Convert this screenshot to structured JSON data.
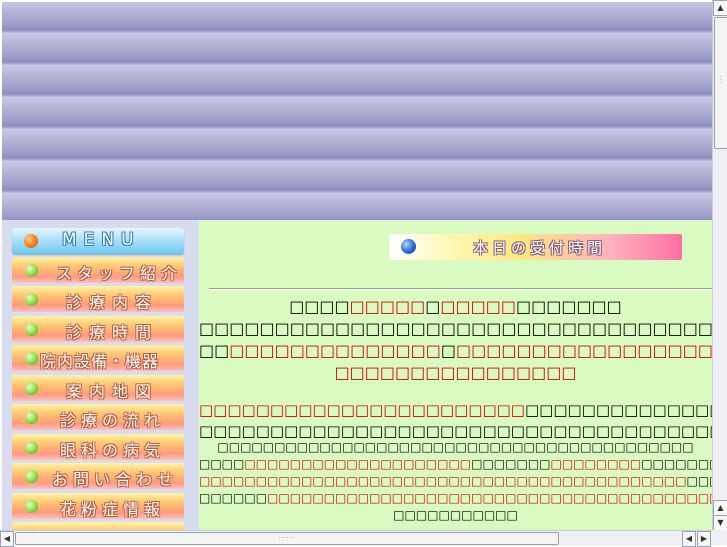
{
  "menu": {
    "header": "MENU",
    "items": [
      {
        "label": "スタッフ紹介"
      },
      {
        "label": "診療内容"
      },
      {
        "label": "診療時間"
      },
      {
        "label": "院内設備・機器"
      },
      {
        "label": "案内地図"
      },
      {
        "label": "診療の流れ"
      },
      {
        "label": "眼科の病気"
      },
      {
        "label": "お問い合わせ"
      },
      {
        "label": "花粉症情報"
      }
    ]
  },
  "main": {
    "today_banner": "本日の受付時間",
    "block1": {
      "line1": {
        "a": "□□□□",
        "b": "□□□□□",
        "c": "□",
        "d": "□□□□□",
        "e": "□□□□□□□"
      },
      "line2": "□□□□□□□□□□□□□□□□□□□□□□□□□□□□□□□□□□□□□□□□",
      "line3": {
        "a": "□□",
        "b": "□□□□□□□□□□□□□□",
        "c": "□",
        "d": "□□□□□□□□□□□□□□□□□"
      },
      "line4": "□□□□□□□□□□□□□□□□"
    },
    "block2": {
      "line1": {
        "a": "□□□□□□□□□□□□□□□□□□□□□□□",
        "b": "□□□□□□□□□□□□□□□□□□□"
      },
      "line2": "□□□□□□□□□□□□□□□□□□□□□□□□□□□□□□□□□□□□□□□□□□□"
    },
    "block3": {
      "line1": "□□□□□□□□□□□□□□□□□□□□□□□□□□□□□□□□□□□□□□□□□□",
      "line2": {
        "a": "□□□□",
        "b": "□□□□□□□□□□□□□□□□□□□□",
        "c": "□□□□□□□",
        "d": "□□□□□□□□",
        "e": "□□□□□□□□□□"
      },
      "line3": {
        "a": "□□□□□□□□□□□□□□□□□□□□□□□□□□□□□□□□□□□□□□□□□□□",
        "b": "□□□□□□□□□□□□□□□"
      },
      "line4": {
        "a": "□□□□□□",
        "b": "□□□□□□□□□□□□□□□□□□□□□□□□□□□□□□□□□□□□□□□□□□",
        "c": "□□□"
      },
      "line5": "□□□□□□□□□□□"
    }
  },
  "colors": {
    "accent_red": "#d40000",
    "main_bg": "#d9fbc2",
    "sidebar_bg": "#d7ddee"
  }
}
